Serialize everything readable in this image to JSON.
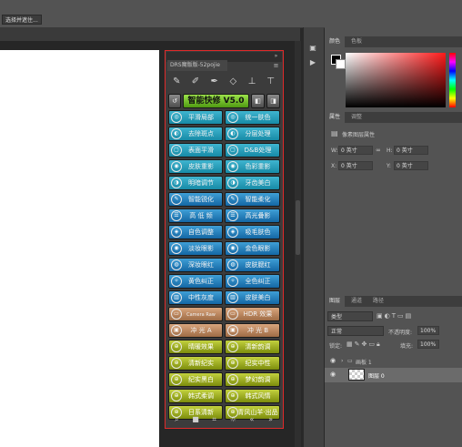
{
  "options_bar": {
    "select_subject": "选择并遮住..."
  },
  "plugin": {
    "tab_label": "DRS魔版版-52pojie",
    "title_banner": "智能快修 V5.0",
    "tools": [
      "brush-tool",
      "brush-tool-2",
      "pen-tool",
      "eraser-tool",
      "stamp-tool",
      "stamp-plus-tool"
    ],
    "rows": [
      [
        "平滑局部",
        "统一肤色"
      ],
      [
        "去除斑点",
        "分层处理"
      ],
      [
        "表面平滑",
        "D&B处理"
      ],
      [
        "皮肤重影",
        "色彩重影"
      ],
      [
        "明暗调节",
        "牙齿美白"
      ],
      [
        "智能锐化",
        "智能柔化"
      ],
      [
        "高 低 频",
        "高光叠影"
      ],
      [
        "自色调整",
        "吸毛肤色"
      ],
      [
        "淡妆眼影",
        "金色眼影"
      ],
      [
        "深妆眼红",
        "皮肤腮红"
      ],
      [
        "黄色纠正",
        "全色纠正"
      ],
      [
        "中性灰度",
        "皮肤美白"
      ],
      [
        "Camera Raw",
        "HDR 效果"
      ],
      [
        "冲 光 A",
        "冲 光 B"
      ],
      [
        "晴暖效果",
        "清新韵调"
      ],
      [
        "清新纪实",
        "纪实中性"
      ],
      [
        "纪实黑白",
        "梦幻韵调"
      ],
      [
        "韩式柔调",
        "韩式风情"
      ],
      [
        "日系清新",
        "青风山羊·出品"
      ]
    ],
    "bottom": [
      "search-icon",
      "stop-icon",
      "crop-icon",
      "sun-icon",
      "prev-icon",
      "next-icon"
    ]
  },
  "right": {
    "color_tabs": [
      "颜色",
      "色板"
    ],
    "props_tabs": [
      "属性",
      "调整"
    ],
    "props_title": "像素图层属性",
    "props": {
      "w_label": "W:",
      "w_value": "0 英寸",
      "h_label": "H:",
      "h_value": "0 英寸",
      "x_label": "X:",
      "x_value": "0 英寸",
      "y_label": "Y:",
      "y_value": "0 英寸"
    },
    "layers_tabs": [
      "图层",
      "通道",
      "路径"
    ],
    "kind": "类型",
    "blend": "正常",
    "opacity_label": "不透明度:",
    "opacity": "100%",
    "lock_label": "锁定:",
    "fill_label": "填充:",
    "fill": "100%",
    "group_name": "画板 1",
    "layer_name": "图层 0"
  }
}
